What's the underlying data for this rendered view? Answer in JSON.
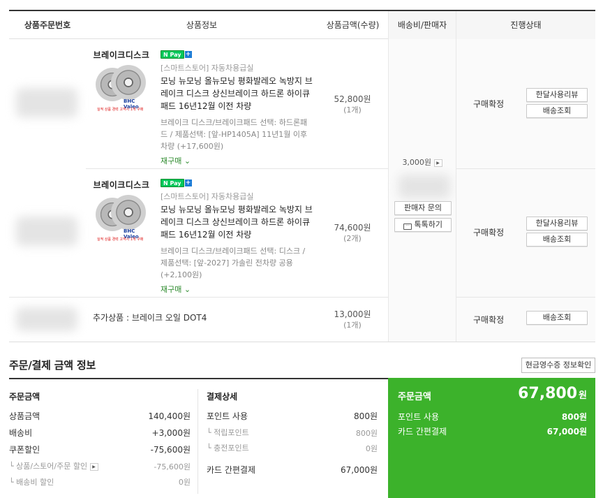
{
  "table": {
    "headers": {
      "order_no": "상품주문번호",
      "product_info": "상품정보",
      "price_qty": "상품금액(수량)",
      "ship_seller": "배송비/판매자",
      "status": "진행상태"
    },
    "items": [
      {
        "thumb_title": "브레이크디스크",
        "thumb_caption": "실적 상품 경력 고객시 1개 구매",
        "logo_text": "BHC Valeo",
        "npay": "N Pay",
        "npay_plus": "+",
        "store": "[스마트스토어] 자동차용급실",
        "name": "모닝 뉴모닝 올뉴모닝 평화발레오 녹방지 브레이크 디스크 상신브레이크 하드론 하이큐패드 16년12월 이전 차량",
        "options": "브레이크 디스크/브레이크패드 선택: 하드론패드 / 제품선택: [앞-HP1405A] 11년1월 이후 차량 (+17,600원)",
        "reorder": "재구매 ⌄",
        "amount": "52,800원",
        "qty": "(1개)",
        "status": "구매확정",
        "btn1": "한달사용리뷰",
        "btn2": "배송조회"
      },
      {
        "thumb_title": "브레이크디스크",
        "thumb_caption": "실적 상품 경력 고객시 1개 구매",
        "logo_text": "BHC Valeo",
        "npay": "N Pay",
        "npay_plus": "+",
        "store": "[스마트스토어] 자동차용급실",
        "name": "모닝 뉴모닝 올뉴모닝 평화발레오 녹방지 브레이크 디스크 상신브레이크 하드론 하이큐패드 16년12월 이전 차량",
        "options": "브레이크 디스크/브레이크패드 선택: 디스크 / 제품선택: [앞-2027] 가솔린 전차량 공용 (+2,100원)",
        "reorder": "재구매 ⌄",
        "amount": "74,600원",
        "qty": "(2개)",
        "status": "구매확정",
        "btn1": "한달사용리뷰",
        "btn2": "배송조회"
      }
    ],
    "extra": {
      "label": "추가상품 : 브레이크 오일 DOT4",
      "amount": "13,000원",
      "qty": "(1개)",
      "status": "구매확정",
      "btn": "배송조회"
    },
    "shipping": {
      "fee": "3,000원",
      "seller_inquiry": "판매자 문의",
      "talk": "톡톡하기"
    }
  },
  "payment": {
    "title": "주문/결제 금액 정보",
    "receipt_button": "현금영수증 정보확인",
    "order_amount": {
      "heading": "주문금액",
      "rows": [
        {
          "label": "상품금액",
          "value": "140,400원"
        },
        {
          "label": "배송비",
          "value": "+3,000원"
        },
        {
          "label": "쿠폰할인",
          "value": "-75,600원"
        },
        {
          "label": "└ 상품/스토어/주문 할인",
          "value": "-75,600원"
        },
        {
          "label": "└ 배송비 할인",
          "value": "0원"
        }
      ]
    },
    "payment_detail": {
      "heading": "결제상세",
      "rows": [
        {
          "label": "포인트 사용",
          "value": "800원"
        },
        {
          "label": "└ 적립포인트",
          "value": "800원"
        },
        {
          "label": "└ 충전포인트",
          "value": "0원"
        },
        {
          "label": "카드 간편결제",
          "value": "67,000원"
        }
      ]
    },
    "summary": {
      "heading": "주문금액",
      "total": "67,800",
      "unit": "원",
      "rows": [
        {
          "label": "포인트 사용",
          "value": "800원"
        },
        {
          "label": "카드 간편결제",
          "value": "67,000원"
        }
      ]
    }
  },
  "colors": {
    "accent_green": "#3cb22b",
    "npay_green": "#03c75a"
  }
}
